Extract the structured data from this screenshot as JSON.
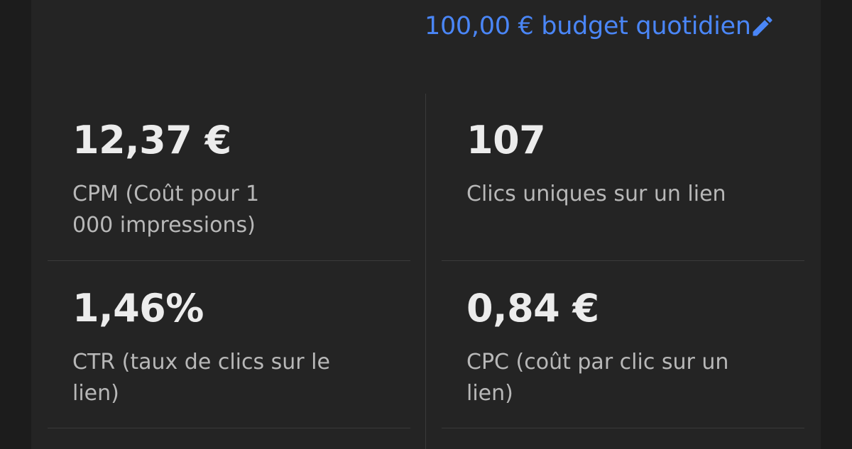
{
  "budget": {
    "label": "100,00 € budget quotidien",
    "edit_icon": "pencil-icon"
  },
  "metrics": [
    {
      "value": "12,37 €",
      "label": "CPM (Coût pour 1 000 impressions)"
    },
    {
      "value": "107",
      "label": "Clics uniques sur un lien"
    },
    {
      "value": "1,46%",
      "label": "CTR (taux de clics sur le lien)"
    },
    {
      "value": "0,84 €",
      "label": "CPC (coût par clic sur un lien)"
    }
  ],
  "colors": {
    "background": "#1c1c1c",
    "card": "#242424",
    "accent": "#4a86f7",
    "value_text": "#ececec",
    "label_text": "#b8b8b8",
    "divider": "#3a3a3a"
  }
}
